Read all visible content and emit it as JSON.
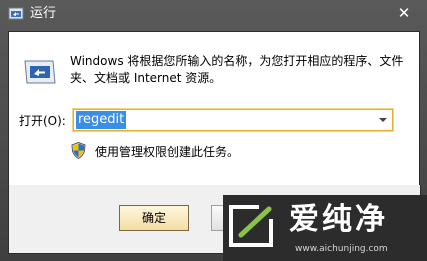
{
  "window": {
    "title": "运行",
    "close_glyph": "✕"
  },
  "description": "Windows 将根据您所输入的名称，为您打开相应的程序、文件夹、文档或 Internet 资源。",
  "open_field": {
    "label": "打开(O):",
    "value": "regedit"
  },
  "uac_text": "使用管理权限创建此任务。",
  "buttons": {
    "ok": "确定"
  },
  "watermark": {
    "name": "爱纯净",
    "url": "www.aichunjing.com"
  },
  "icons": {
    "app": "run-icon",
    "shield": "uac-shield-icon",
    "dropdown": "chevron-down-icon",
    "logo": "aichunjing-logo"
  },
  "colors": {
    "accent": "#e8b030",
    "selection": "#3a8ee6",
    "watermark_green": "#8bc34a"
  }
}
